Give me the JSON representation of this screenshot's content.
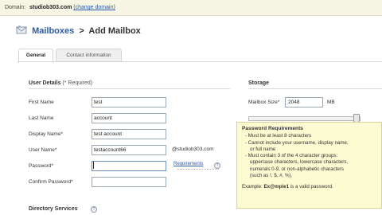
{
  "domain_bar": {
    "label": "Domain:",
    "domain": "studiob303.com",
    "change_link": "(change domain)"
  },
  "header": {
    "breadcrumb_link": "Mailboxes",
    "separator": ">",
    "page_title": "Add Mailbox"
  },
  "tabs": [
    {
      "label": "General",
      "active": true
    },
    {
      "label": "Contact information",
      "active": false
    }
  ],
  "user_details": {
    "title": "User Details",
    "required_note": "(* Required)",
    "fields": {
      "first_name": {
        "label": "First Name",
        "value": "test"
      },
      "last_name": {
        "label": "Last Name",
        "value": "account"
      },
      "display_name": {
        "label": "Display Name*",
        "value": "test account"
      },
      "user_name": {
        "label": "User Name*",
        "value": "testaccount66",
        "suffix": "@studiob303.com"
      },
      "password": {
        "label": "Password*",
        "value": ""
      },
      "confirm_password": {
        "label": "Confirm Password*",
        "value": ""
      }
    },
    "requirements_link": "Requirements"
  },
  "storage": {
    "title": "Storage",
    "mailbox_size_label": "Mailbox Size*",
    "mailbox_size_value": "2048",
    "unit": "MB"
  },
  "directory_services": {
    "title": "Directory Services"
  },
  "password_tooltip": {
    "title": "Password Requirements",
    "rules": [
      "- Must be at least 8 characters",
      "- Cannot include your username, display name,",
      "  or full name",
      "- Must contain 3 of the 4 character groups:",
      "  uppercase characters, lowercase characters,",
      "  numerals 0-9, or non-alphabetic characters",
      "  (such as !, $, #, %)."
    ],
    "example_prefix": "Example:",
    "example_value": "Ex@mple1",
    "example_suffix": "is a valid password."
  },
  "colors": {
    "link": "#2a5aa8",
    "domain_bar_bg": "#f7f6e4",
    "tooltip_bg": "#fdfbd2"
  }
}
